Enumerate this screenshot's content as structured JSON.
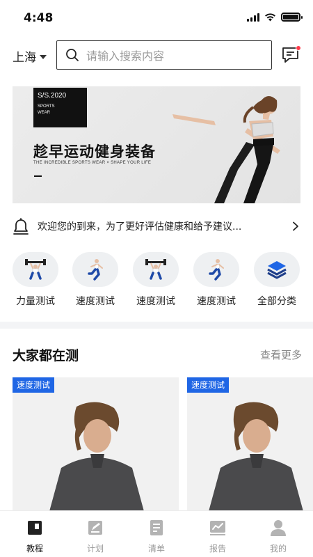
{
  "status_bar": {
    "time": "4:48"
  },
  "header": {
    "city": "上海",
    "search_placeholder": "请输入搜索内容"
  },
  "banner": {
    "tag_line1": "S/S.2020",
    "tag_line2": "SPORTS",
    "tag_line3": "WEAR",
    "title": "趁早运动健身装备",
    "subtitle": "THE INCREDIBLE SPORTS WEAR × SHAPE YOUR LIFE"
  },
  "notice": {
    "text": "欢迎您的到来，为了更好评估健康和给予建议..."
  },
  "categories": [
    {
      "label": "力量测试",
      "icon": "weightlifting-icon"
    },
    {
      "label": "速度测试",
      "icon": "running-icon"
    },
    {
      "label": "速度测试",
      "icon": "weightlifting-icon"
    },
    {
      "label": "速度测试",
      "icon": "running-icon"
    },
    {
      "label": "全部分类",
      "icon": "layers-icon"
    }
  ],
  "section": {
    "title": "大家都在测",
    "more": "查看更多"
  },
  "cards": [
    {
      "badge": "速度测试"
    },
    {
      "badge": "速度测试"
    }
  ],
  "tabs": [
    {
      "label": "教程",
      "icon": "tutorial-icon",
      "active": true
    },
    {
      "label": "计划",
      "icon": "plan-icon",
      "active": false
    },
    {
      "label": "清单",
      "icon": "list-icon",
      "active": false
    },
    {
      "label": "报告",
      "icon": "report-icon",
      "active": false
    },
    {
      "label": "我的",
      "icon": "profile-icon",
      "active": false
    }
  ],
  "colors": {
    "accent_blue": "#1f66e5",
    "notification_dot": "#ff3b4a",
    "category_bg": "#eef0f2"
  }
}
